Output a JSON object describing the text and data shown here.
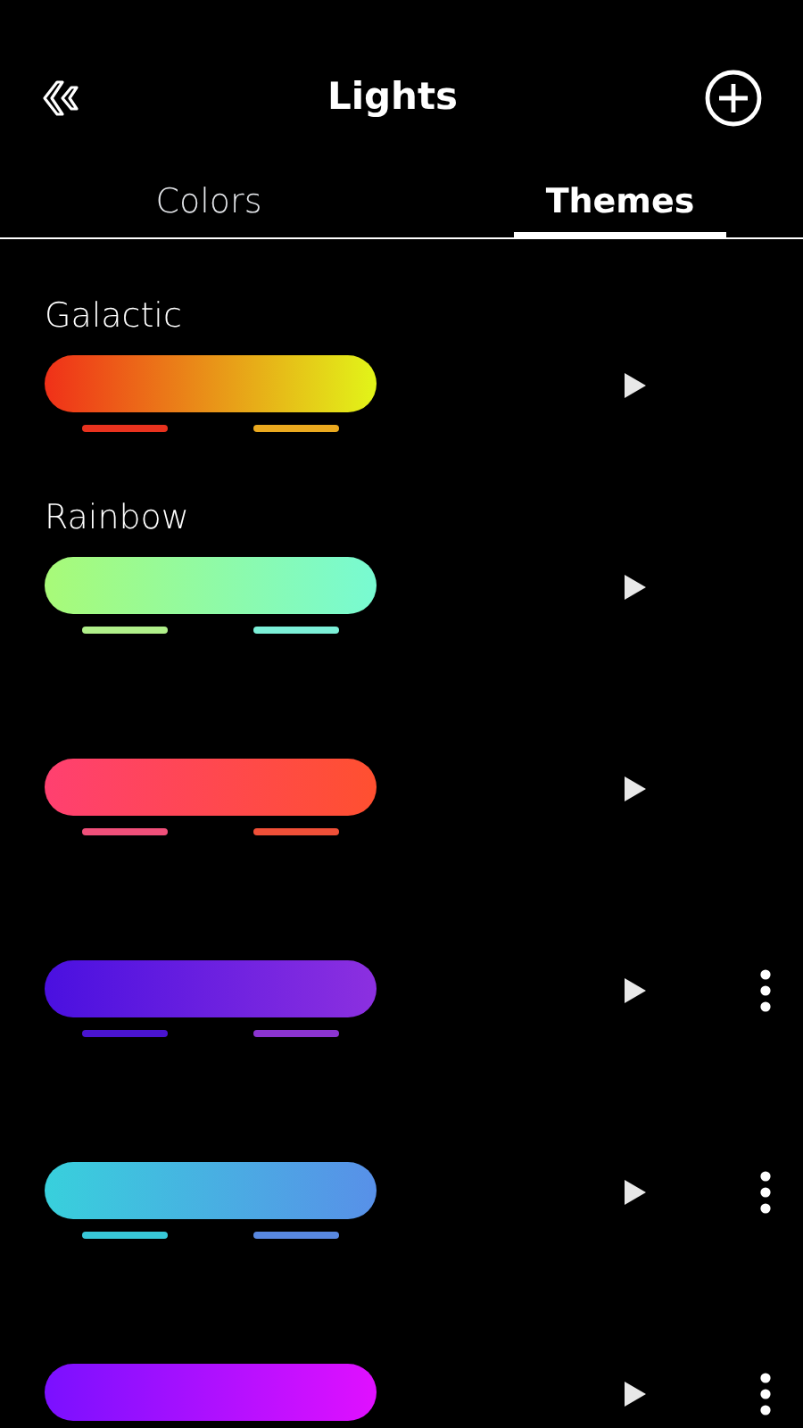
{
  "header": {
    "title": "Lights"
  },
  "tabs": [
    {
      "label": "Colors",
      "selected": false
    },
    {
      "label": "Themes",
      "selected": true
    }
  ],
  "themes": [
    {
      "name": "Galactic",
      "stops": [
        {
          "color": "#f03018"
        },
        {
          "color": "#e2f518"
        }
      ],
      "swatches": [
        {
          "color": "#e8321e"
        },
        {
          "color": "#eaa91f"
        }
      ],
      "has_menu": false
    },
    {
      "name": "Rainbow",
      "stops": [
        {
          "color": "#a8fa78"
        },
        {
          "color": "#78fad2"
        }
      ],
      "swatches": [
        {
          "color": "#b0f08a"
        },
        {
          "color": "#7cf0d8"
        }
      ],
      "has_menu": false
    },
    {
      "stops": [
        {
          "color": "#ff4070"
        },
        {
          "color": "#ff5030"
        }
      ],
      "swatches": [
        {
          "color": "#f0507a"
        },
        {
          "color": "#f05038"
        }
      ],
      "has_menu": false
    },
    {
      "stops": [
        {
          "color": "#4a10e0"
        },
        {
          "color": "#8c30e0"
        }
      ],
      "swatches": [
        {
          "color": "#4a14d0"
        },
        {
          "color": "#8c34d0"
        }
      ],
      "has_menu": true
    },
    {
      "stops": [
        {
          "color": "#38d0dc"
        },
        {
          "color": "#5890e8"
        }
      ],
      "swatches": [
        {
          "color": "#38c8d8"
        },
        {
          "color": "#5888e0"
        }
      ],
      "has_menu": true
    },
    {
      "stops": [
        {
          "color": "#7a10ff"
        },
        {
          "color": "#e010ff"
        }
      ],
      "has_menu": true
    }
  ]
}
